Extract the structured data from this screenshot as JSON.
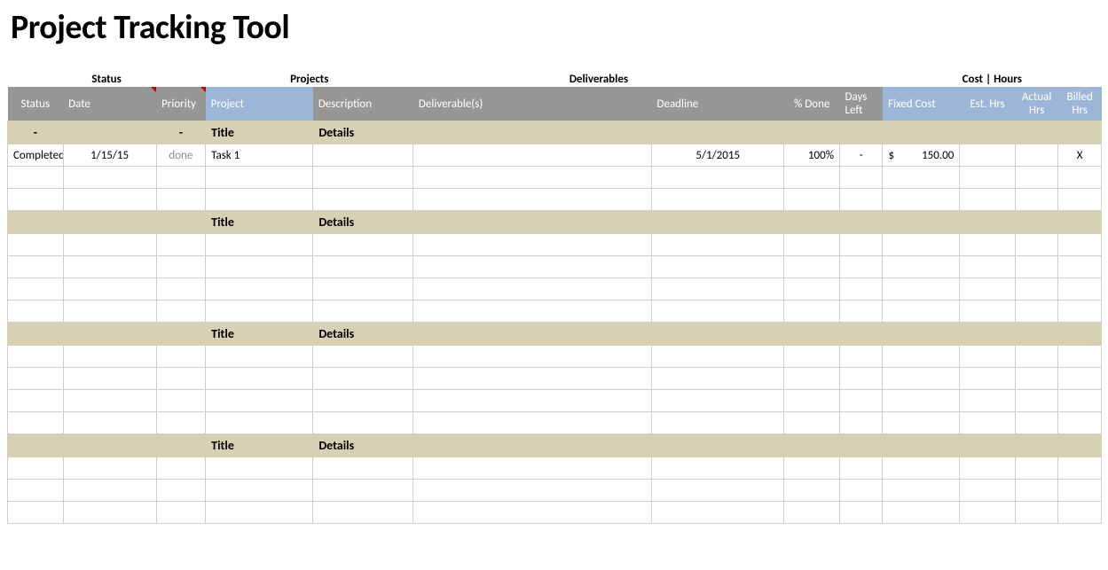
{
  "title": "Project Tracking Tool",
  "groups": {
    "status": "Status",
    "projects": "Projects",
    "deliverables": "Deliverables",
    "cost_hours": "Cost | Hours"
  },
  "columns": {
    "status": "Status",
    "date": "Date",
    "priority": "Priority",
    "project": "Project",
    "description": "Description",
    "deliverables": "Deliverable(s)",
    "deadline": "Deadline",
    "pct_done": "% Done",
    "days_left": "Days Left",
    "fixed_cost": "Fixed Cost",
    "est_hrs": "Est. Hrs",
    "actual_hrs": "Actual Hrs",
    "billed_hrs": "Billed Hrs"
  },
  "section_labels": {
    "status_dash": "-",
    "priority_dash": "-",
    "title": "Title",
    "details": "Details"
  },
  "rows": {
    "r1": {
      "status": "Completed",
      "date": "1/15/15",
      "priority": "done",
      "project": "Task 1",
      "description": "",
      "deliverables": "",
      "deadline": "5/1/2015",
      "pct_done": "100%",
      "days_left": "-",
      "fixed_cost_sym": "$",
      "fixed_cost_val": "150.00",
      "est_hrs": "",
      "actual_hrs": "",
      "billed_hrs": "X"
    }
  }
}
